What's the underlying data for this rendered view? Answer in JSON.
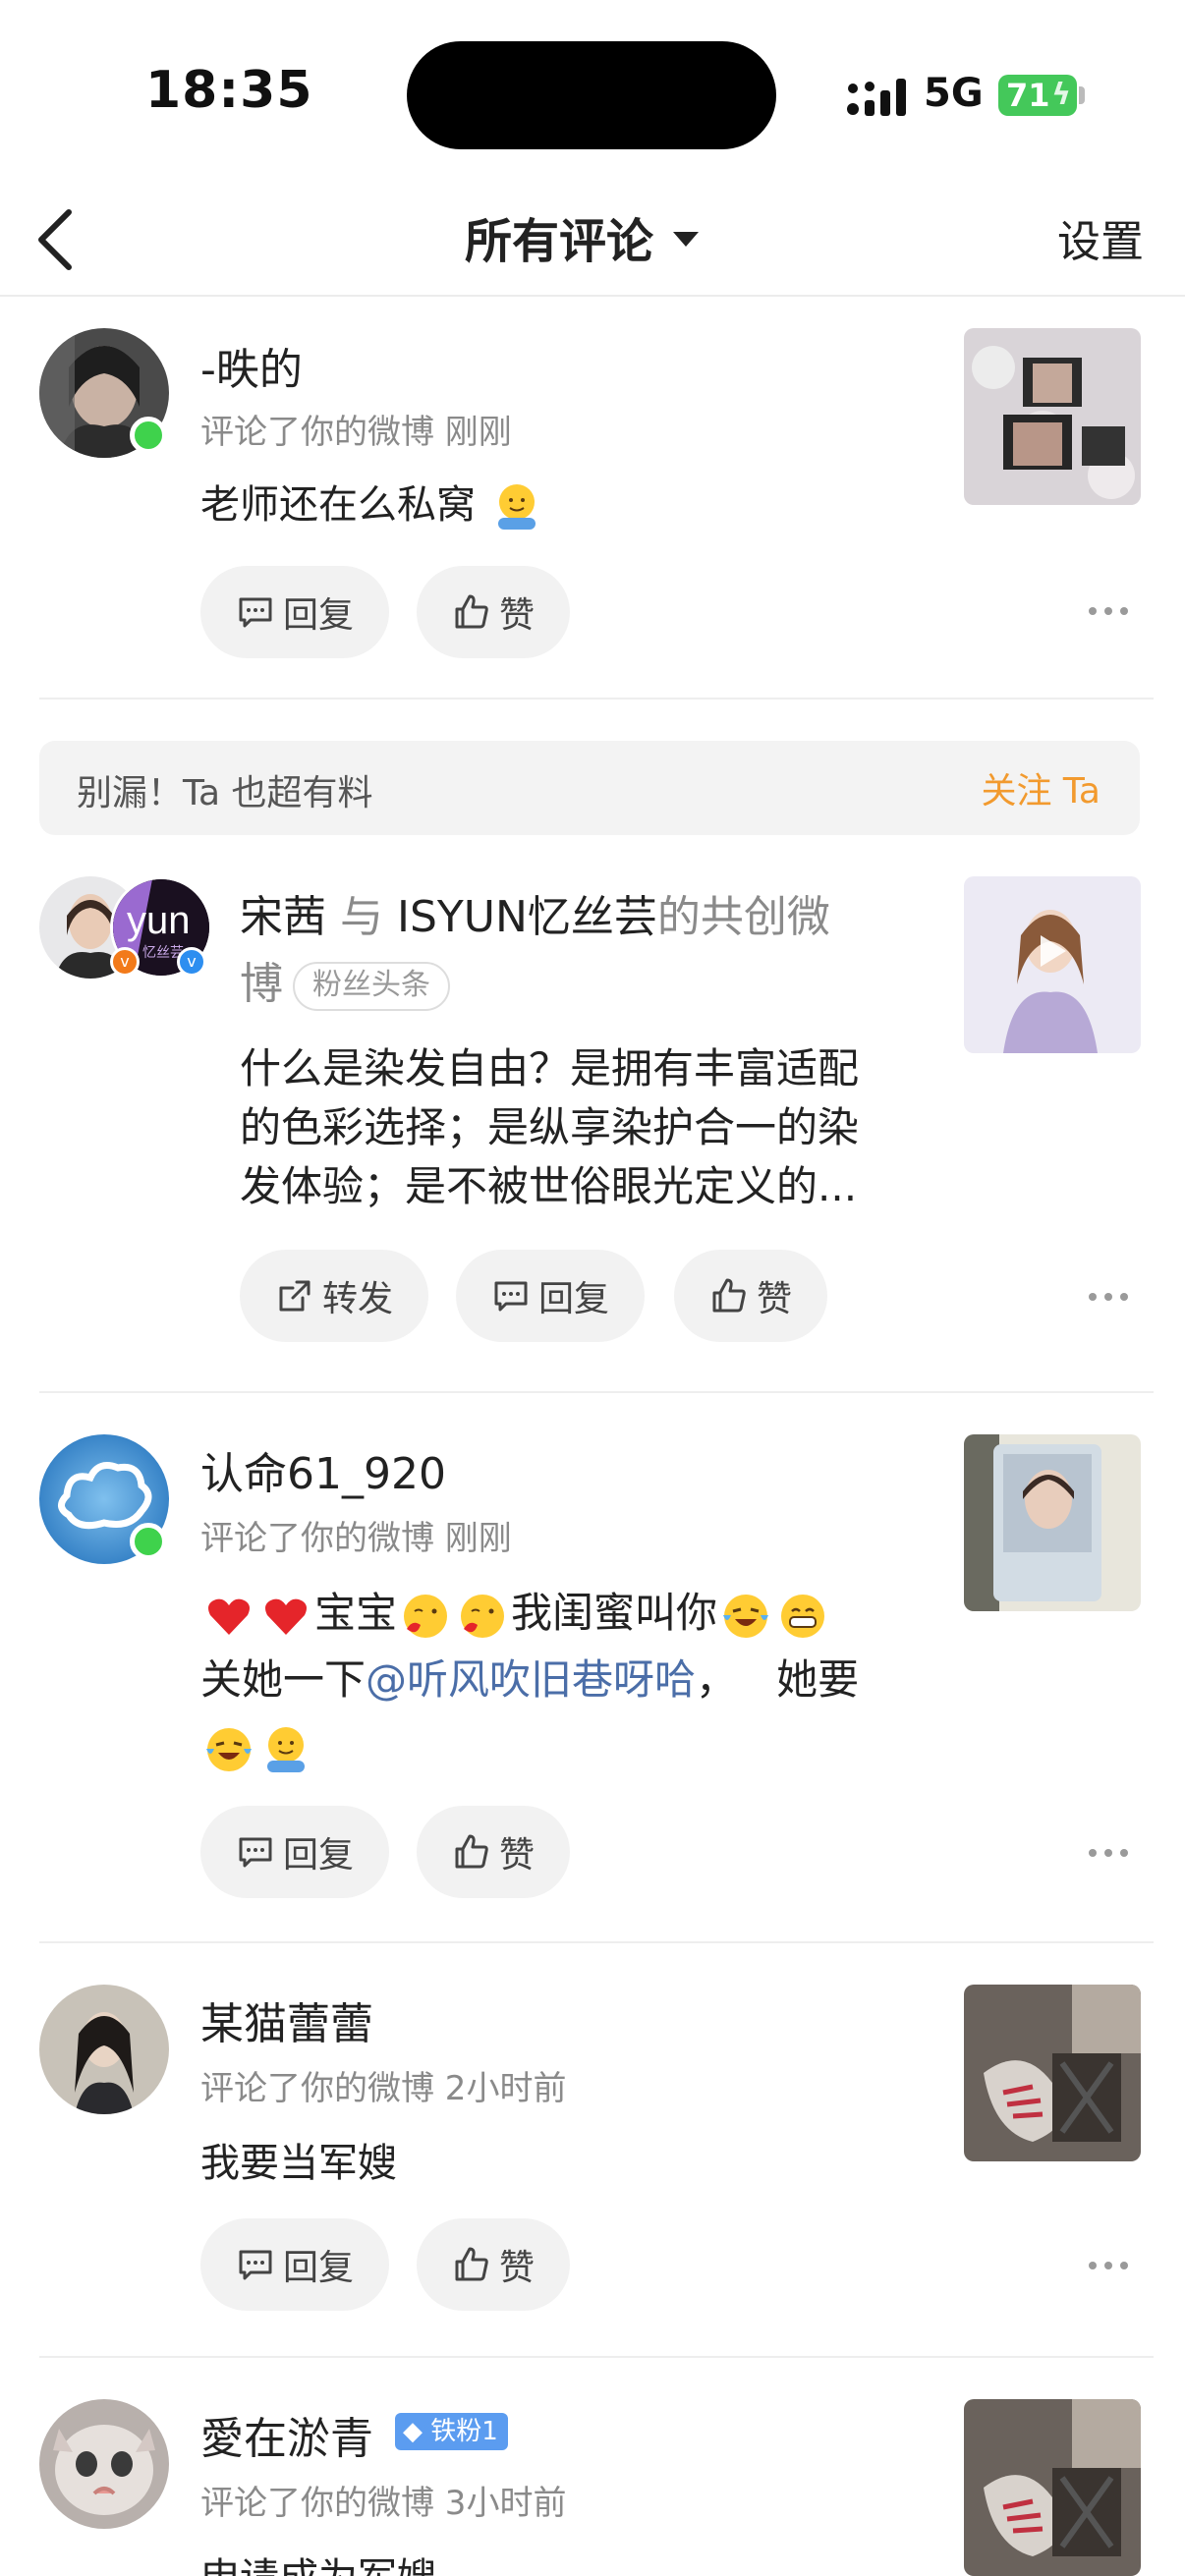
{
  "status": {
    "time": "18:35",
    "network": "5G",
    "battery": "71"
  },
  "nav": {
    "title": "所有评论",
    "settings": "设置"
  },
  "buttons": {
    "reply": "回复",
    "like": "赞",
    "repost": "转发"
  },
  "promo": {
    "text": "别漏！Ta 也超有料",
    "follow": "关注 Ta"
  },
  "comments": [
    {
      "name": "-昳的",
      "meta": "评论了你的微博   刚刚",
      "text": "老师还在么私窝"
    },
    {
      "name": "认命61_920",
      "meta": "评论了你的微博   刚刚",
      "line1": "宝宝",
      "line1b": "我闺蜜叫你",
      "line2_pre": "关她一下",
      "mention": "@听风吹旧巷呀哈",
      "line2_post": "，   她要"
    },
    {
      "name": "某猫蕾蕾",
      "meta": "评论了你的微博   2小时前",
      "text": "我要当军嫂"
    },
    {
      "name": "愛在淤青",
      "meta": "评论了你的微博   3小时前",
      "badge": "铁粉1",
      "text": "申请成为军嫂"
    }
  ],
  "cocreate": {
    "name1": "宋茜",
    "connector": "与",
    "name2": "ISYUN忆丝芸",
    "suffix1": "的共创微",
    "suffix2": "博",
    "badge": "粉丝头条",
    "text_lines": [
      "什么是染发自由？是拥有丰富适配",
      "的色彩选择；是纵享染护合一的染",
      "发体验；是不被世俗眼光定义的..."
    ],
    "avatar_text": "yun",
    "avatar_sub": "忆丝芸"
  },
  "colors": {
    "accent_orange": "#f29a2e",
    "online": "#3fd24c",
    "mention": "#4b6ea8",
    "battery": "#44c85a"
  }
}
